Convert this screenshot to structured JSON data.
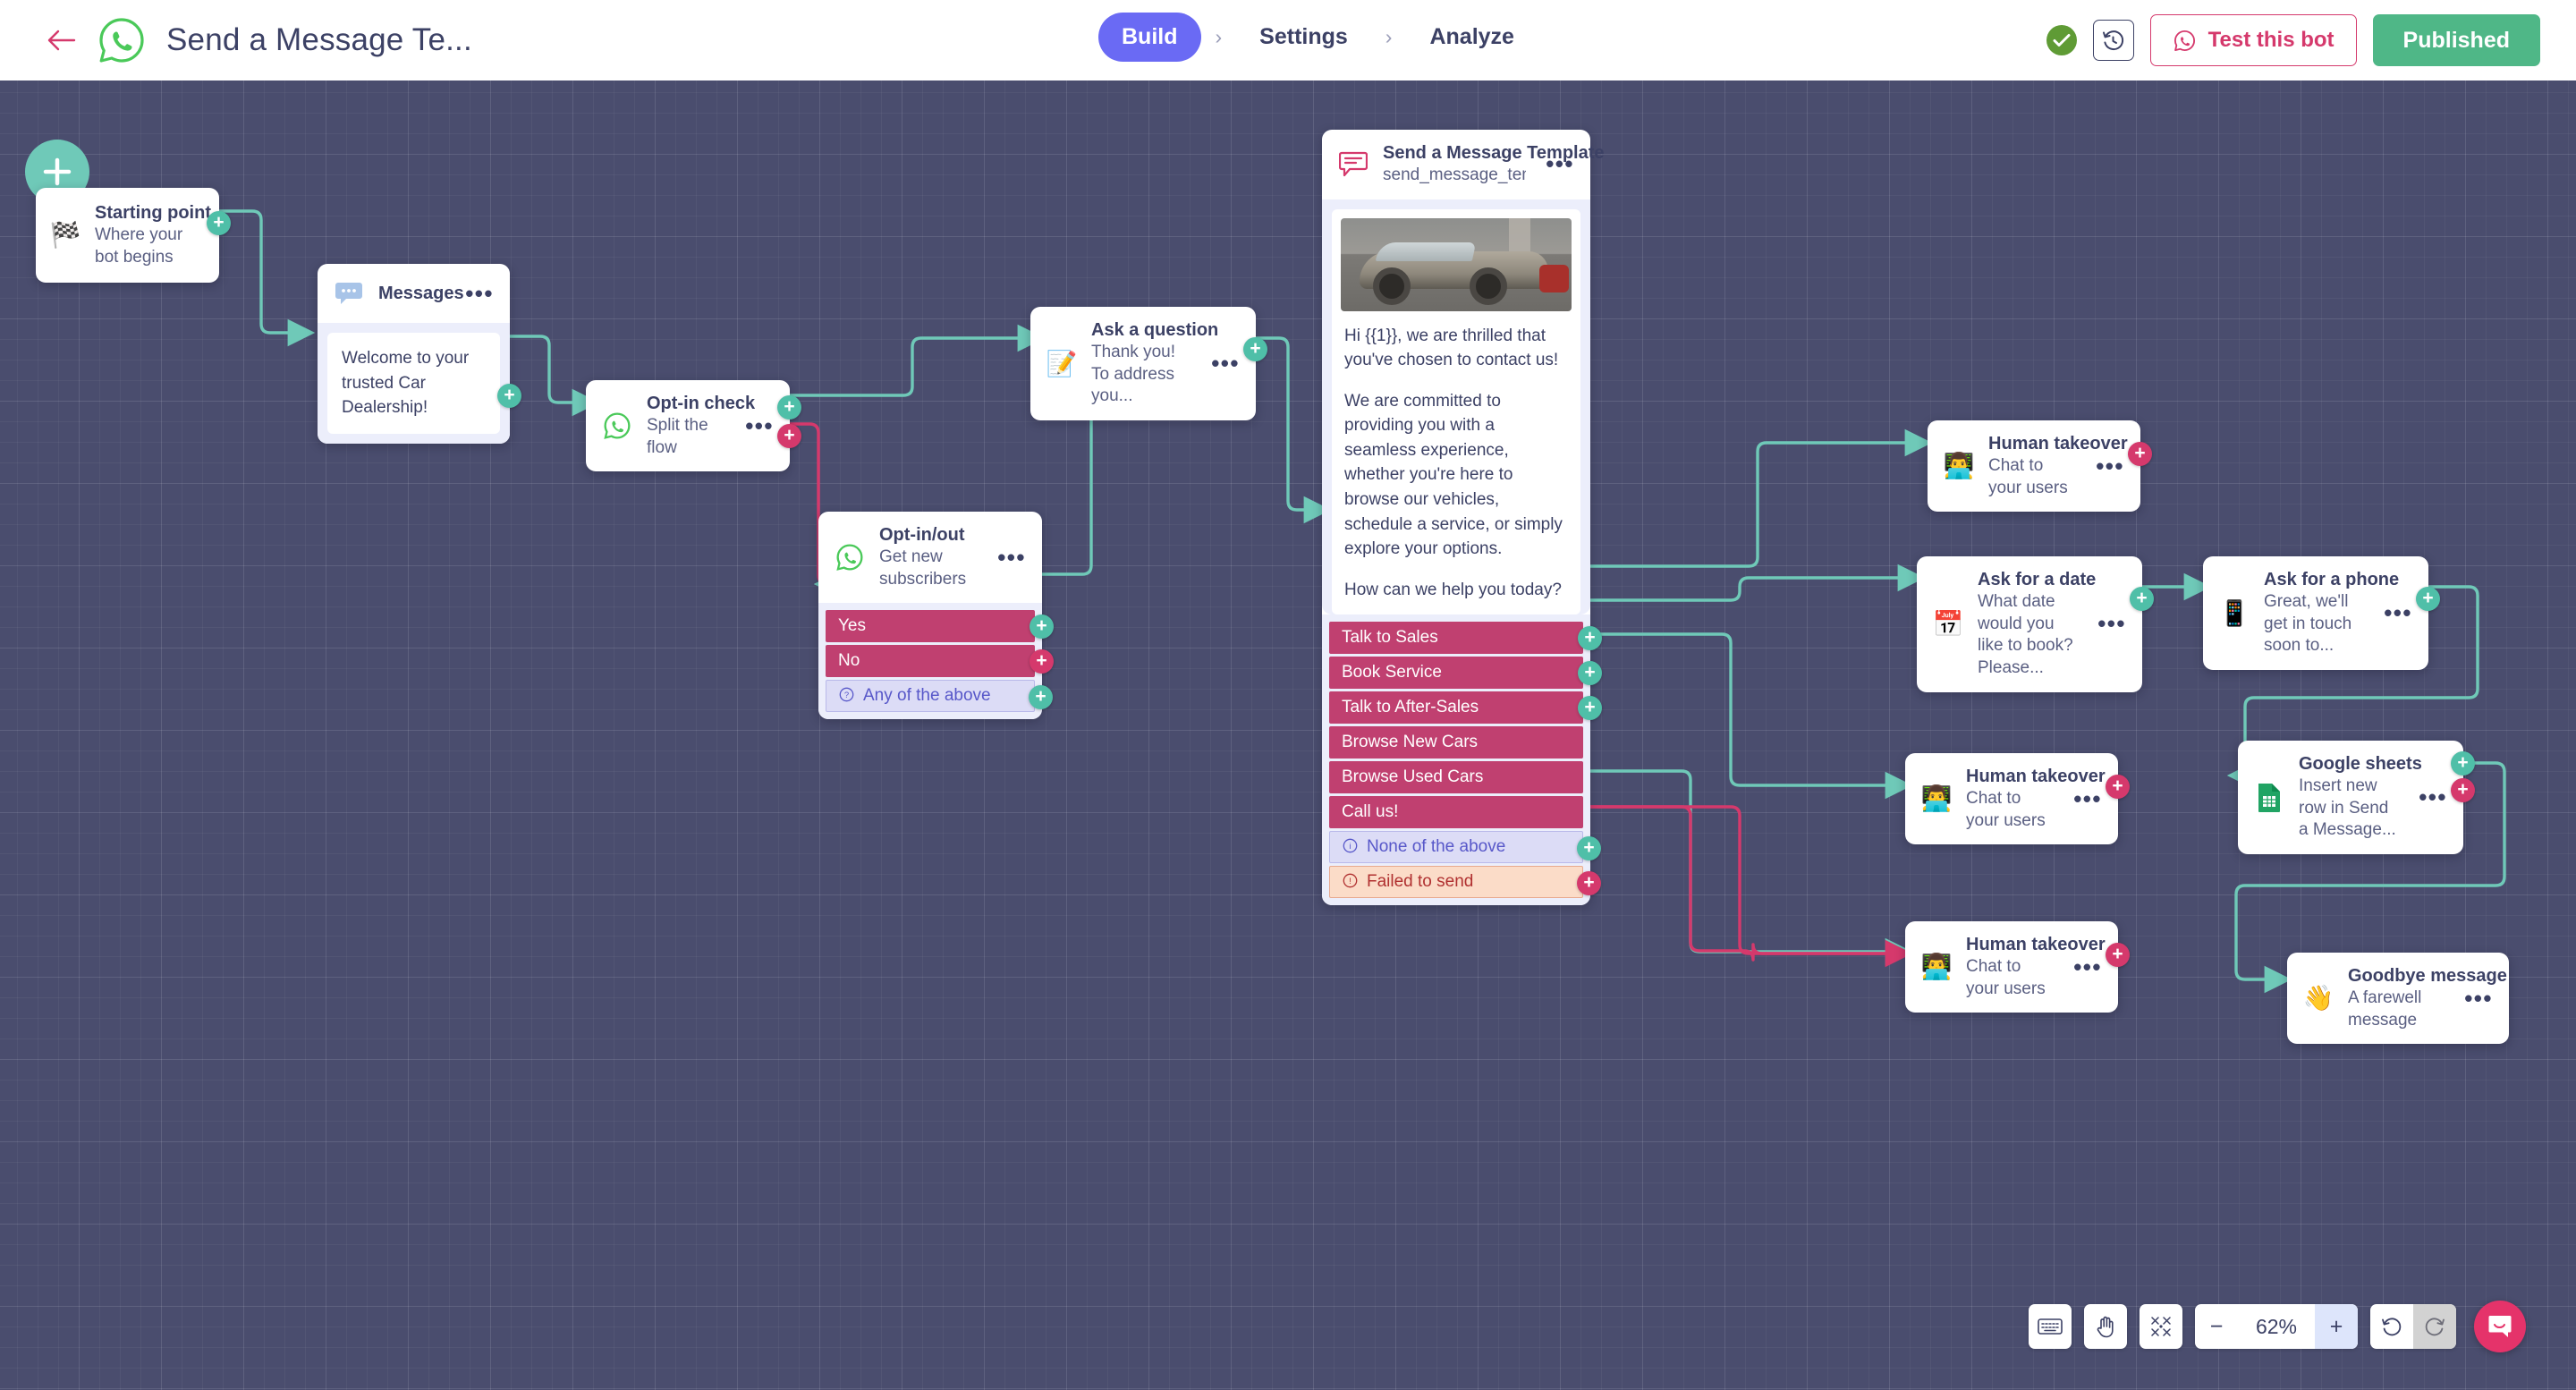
{
  "header": {
    "back_icon": "back-arrow-icon",
    "logo_icon": "whatsapp-logo-icon",
    "title": "Send a Message Te...",
    "tabs": [
      {
        "label": "Build",
        "active": true
      },
      {
        "label": "Settings",
        "active": false
      },
      {
        "label": "Analyze",
        "active": false
      }
    ],
    "separator": "›",
    "status_icon": "check-circle-icon",
    "history_icon": "history-clock-icon",
    "test_bot_label": "Test this bot",
    "test_bot_icon": "whatsapp-icon",
    "published_label": "Published",
    "colors": {
      "accent_purple": "#6a6af4",
      "brand_pink": "#d5396c",
      "publish_green": "#4fb787",
      "status_green": "#5f9b35"
    }
  },
  "canvas": {
    "add_node_button": "+",
    "background": "#4a4d6e",
    "edge_color_success": "#6fc9b8",
    "edge_color_failure": "#d5396c"
  },
  "nodes": {
    "starting_point": {
      "icon": "checkered-flag-icon",
      "title": "Starting point",
      "subtitle": "Where your bot begins"
    },
    "messages": {
      "icon": "message-dots-icon",
      "title": "Messages",
      "menu": "•••",
      "bubble": "Welcome to your trusted Car Dealership!"
    },
    "optin_check": {
      "icon": "whatsapp-icon",
      "title": "Opt-in check",
      "subtitle": "Split the flow",
      "menu": "•••"
    },
    "optin_out": {
      "icon": "whatsapp-icon",
      "title": "Opt-in/out",
      "subtitle": "Get new subscribers",
      "menu": "•••",
      "options": [
        {
          "label": "Yes",
          "kind": "choice",
          "port": "green"
        },
        {
          "label": "No",
          "kind": "choice",
          "port": "pink"
        },
        {
          "label": "Any of the above",
          "kind": "info",
          "icon": "question-circle-icon",
          "port": "green"
        }
      ]
    },
    "ask_a_question": {
      "icon": "memo-pencil-icon",
      "title": "Ask a question",
      "subtitle": "Thank you! To address you...",
      "menu": "•••"
    },
    "send_message_template": {
      "icon": "message-template-icon",
      "title": "Send a Message Template",
      "subtitle": "send_message_temp",
      "menu": "•••",
      "image_alt": "classic-car-photo",
      "body_lines": [
        "Hi {{1}}, we are thrilled that you've chosen to contact us!",
        "We are committed to providing you with a seamless experience, whether you're here to browse our vehicles, schedule a service, or simply explore your options.",
        "How can we help you today?"
      ],
      "options": [
        {
          "label": "Talk to Sales",
          "kind": "choice",
          "port": "green"
        },
        {
          "label": "Book Service",
          "kind": "choice",
          "port": "green"
        },
        {
          "label": "Talk to After-Sales",
          "kind": "choice",
          "port": "green"
        },
        {
          "label": "Browse New Cars",
          "kind": "choice",
          "port": "none"
        },
        {
          "label": "Browse Used Cars",
          "kind": "choice",
          "port": "none"
        },
        {
          "label": "Call us!",
          "kind": "choice",
          "port": "none"
        },
        {
          "label": "None of the above",
          "kind": "info",
          "icon": "info-circle-icon",
          "port": "green"
        },
        {
          "label": "Failed to send",
          "kind": "fail",
          "icon": "error-circle-icon",
          "port": "pink"
        }
      ]
    },
    "human_takeover_1": {
      "icon": "person-laptop-icon",
      "title": "Human takeover",
      "subtitle": "Chat to your users",
      "menu": "•••"
    },
    "ask_for_a_date": {
      "icon": "calendar-icon",
      "title": "Ask for a date",
      "subtitle": "What date would you like to book? Please...",
      "menu": "•••"
    },
    "ask_for_a_phone": {
      "icon": "mobile-phone-icon",
      "title": "Ask for a phone",
      "subtitle": "Great, we'll get in touch soon to...",
      "menu": "•••"
    },
    "human_takeover_2": {
      "icon": "person-laptop-icon",
      "title": "Human takeover",
      "subtitle": "Chat to your users",
      "menu": "•••"
    },
    "google_sheets": {
      "icon": "google-sheets-icon",
      "title": "Google sheets",
      "subtitle": "Insert new row in Send a Message...",
      "menu": "•••"
    },
    "human_takeover_3": {
      "icon": "person-laptop-icon",
      "title": "Human takeover",
      "subtitle": "Chat to your users",
      "menu": "•••"
    },
    "goodbye_message": {
      "icon": "waving-hand-icon",
      "title": "Goodbye message",
      "subtitle": "A farewell message",
      "menu": "•••"
    }
  },
  "toolbar": {
    "keyboard_icon": "keyboard-icon",
    "hand_icon": "hand-pan-icon",
    "fit_icon": "fit-to-screen-icon",
    "zoom_out": "−",
    "zoom_level": "62%",
    "zoom_in": "+",
    "undo_icon": "undo-icon",
    "redo_icon": "redo-icon",
    "chat_icon": "chat-bubble-icon"
  }
}
